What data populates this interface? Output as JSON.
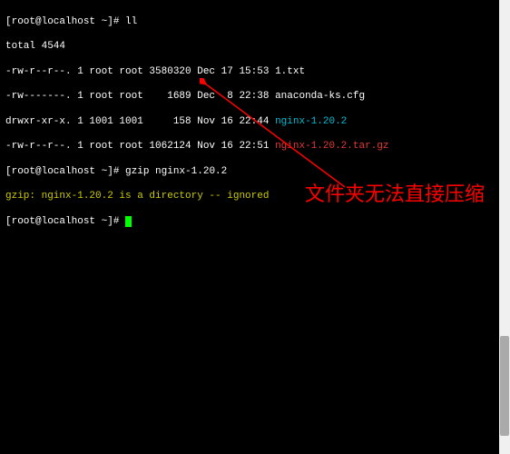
{
  "prompt1": "[root@localhost ~]# ",
  "cmd1": "ll",
  "total_line": "total 4544",
  "rows": [
    {
      "perm": "-rw-r--r--. 1 root root 3580320 Dec 17 15:53 ",
      "name": "1.txt",
      "cls": ""
    },
    {
      "perm": "-rw-------. 1 root root    1689 Dec  8 22:38 ",
      "name": "anaconda-ks.cfg",
      "cls": ""
    },
    {
      "perm": "drwxr-xr-x. 1 1001 1001     158 Nov 16 22:44 ",
      "name": "nginx-1.20.2",
      "cls": "cyan"
    },
    {
      "perm": "-rw-r--r--. 1 root root 1062124 Nov 16 22:51 ",
      "name": "nginx-1.20.2.tar.gz",
      "cls": "red"
    }
  ],
  "prompt2": "[root@localhost ~]# ",
  "cmd2": "gzip nginx-1.20.2",
  "error_line": "gzip: nginx-1.20.2 is a directory -- ignored",
  "prompt3": "[root@localhost ~]# ",
  "annotation_text": "文件夹无法直接压缩",
  "colors": {
    "cyan": "#00bcd4",
    "red": "#e53935",
    "annotation": "#ff0000",
    "cursor": "#00ff00"
  }
}
